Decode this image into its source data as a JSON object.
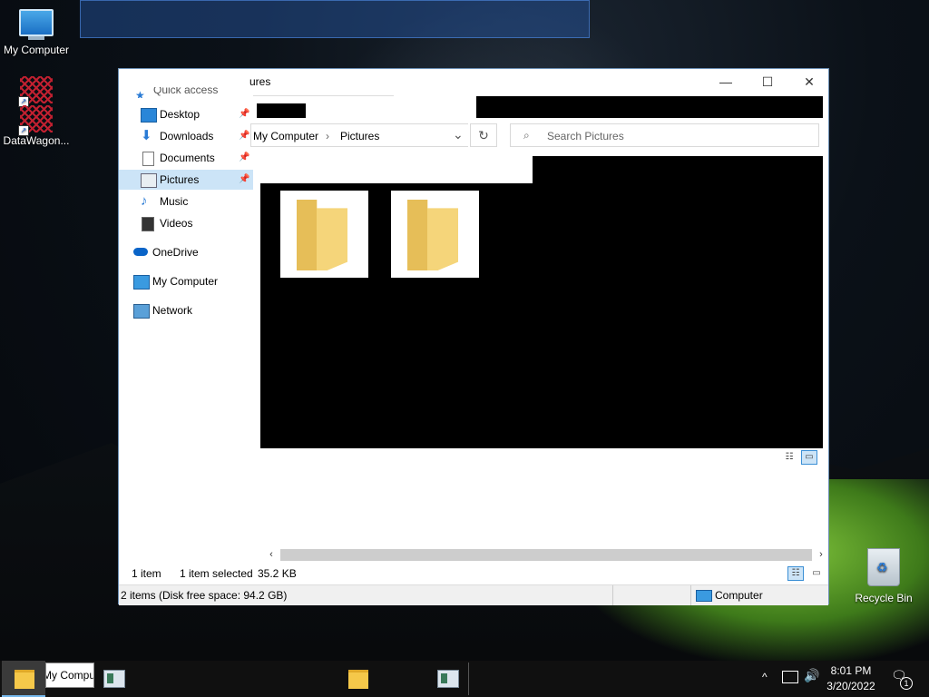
{
  "desktop": {
    "icons": [
      {
        "label": "My Computer"
      },
      {
        "label": ""
      },
      {
        "label": "DataWagon..."
      },
      {
        "label": "Recycle Bin"
      }
    ]
  },
  "window": {
    "title": "ures",
    "controls": {
      "minimize": "—",
      "maximize": "☐",
      "close": "✕"
    },
    "address": {
      "segments": [
        "My Computer",
        "Pictures"
      ],
      "separator": "›",
      "dropdown": "⌄"
    },
    "refresh_icon": "↻",
    "search": {
      "placeholder": "Search Pictures",
      "icon": "⌕"
    },
    "nav": {
      "quick_access": "Quick access",
      "items": [
        {
          "label": "Desktop",
          "icon": "desktop-icon",
          "pinned": true
        },
        {
          "label": "Downloads",
          "icon": "downloads-icon",
          "pinned": true
        },
        {
          "label": "Documents",
          "icon": "documents-icon",
          "pinned": true
        },
        {
          "label": "Pictures",
          "icon": "pictures-icon",
          "pinned": true,
          "selected": true
        },
        {
          "label": "Music",
          "icon": "music-icon",
          "pinned": false
        },
        {
          "label": "Videos",
          "icon": "videos-icon",
          "pinned": false
        },
        {
          "label": "OneDrive",
          "icon": "onedrive-icon",
          "pinned": false
        },
        {
          "label": "My Computer",
          "icon": "computer-icon",
          "pinned": false
        },
        {
          "label": "Network",
          "icon": "network-icon",
          "pinned": false
        }
      ]
    },
    "content": {
      "folder_count": 2
    },
    "status": {
      "items": "1 item",
      "selected": "1 item selected",
      "size": "35.2 KB",
      "disk": "2 items (Disk free space: 94.2 GB)",
      "location": "Computer"
    },
    "colors": {
      "selection": "#cce4f7",
      "accent": "#0078d7",
      "folder": "#f5d57a"
    }
  },
  "taskbar": {
    "tooltip": "My Computer",
    "clock": {
      "time": "8:01 PM",
      "date": "3/20/2022"
    },
    "tray": {
      "chevron": "^",
      "network": "network-icon",
      "volume": "volume-icon"
    },
    "notification_count": "1"
  }
}
